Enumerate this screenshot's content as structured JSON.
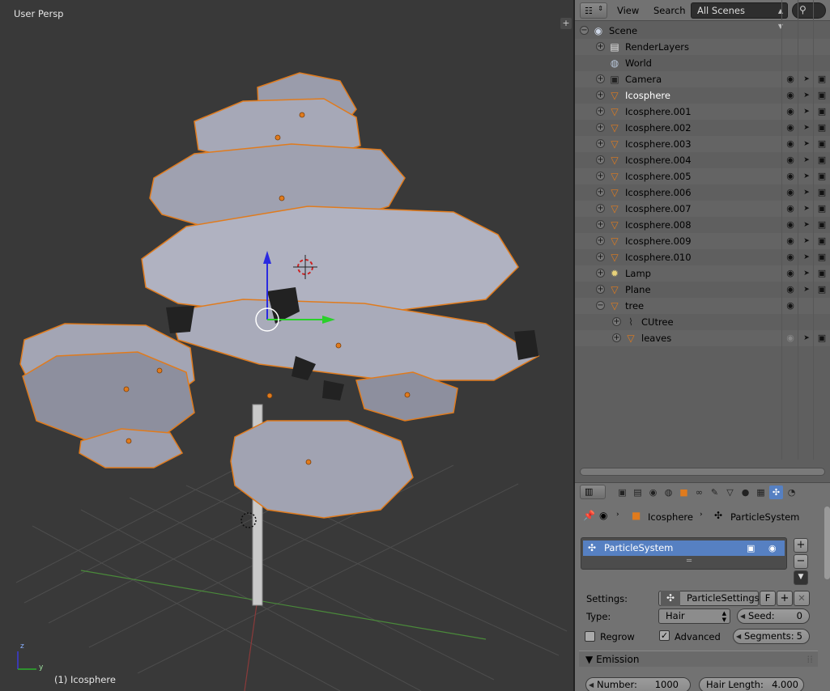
{
  "viewport": {
    "title": "User Persp",
    "active_object": "(1) Icosphere",
    "axis_z": "z",
    "axis_y": "y",
    "plus_button": "+"
  },
  "outliner": {
    "header": {
      "menu_view": "View",
      "menu_search": "Search",
      "scene_select": "All Scenes"
    },
    "rows": [
      {
        "name": "Scene",
        "level": 0,
        "expand": "−",
        "icon": "scene-icon",
        "glyph": "◉",
        "color": "#cfd8e8"
      },
      {
        "name": "RenderLayers",
        "level": 1,
        "expand": "+",
        "icon": "render-layers-icon",
        "glyph": "▤",
        "color": "#e6e6e6"
      },
      {
        "name": "World",
        "level": 1,
        "expand": "",
        "icon": "world-icon",
        "glyph": "◍",
        "color": "#b9c8dc"
      },
      {
        "name": "Camera",
        "level": 1,
        "expand": "+",
        "icon": "camera-icon",
        "glyph": "▣",
        "color": "#222222",
        "restrict": true
      },
      {
        "name": "Icosphere",
        "level": 1,
        "expand": "+",
        "icon": "mesh-object-icon",
        "glyph": "▽",
        "color": "#e07b1d",
        "selected": true,
        "restrict": true
      },
      {
        "name": "Icosphere.001",
        "level": 1,
        "expand": "+",
        "icon": "mesh-object-icon",
        "glyph": "▽",
        "color": "#e07b1d",
        "restrict": true
      },
      {
        "name": "Icosphere.002",
        "level": 1,
        "expand": "+",
        "icon": "mesh-object-icon",
        "glyph": "▽",
        "color": "#e07b1d",
        "restrict": true
      },
      {
        "name": "Icosphere.003",
        "level": 1,
        "expand": "+",
        "icon": "mesh-object-icon",
        "glyph": "▽",
        "color": "#e07b1d",
        "restrict": true
      },
      {
        "name": "Icosphere.004",
        "level": 1,
        "expand": "+",
        "icon": "mesh-object-icon",
        "glyph": "▽",
        "color": "#e07b1d",
        "restrict": true
      },
      {
        "name": "Icosphere.005",
        "level": 1,
        "expand": "+",
        "icon": "mesh-object-icon",
        "glyph": "▽",
        "color": "#e07b1d",
        "restrict": true
      },
      {
        "name": "Icosphere.006",
        "level": 1,
        "expand": "+",
        "icon": "mesh-object-icon",
        "glyph": "▽",
        "color": "#e07b1d",
        "restrict": true
      },
      {
        "name": "Icosphere.007",
        "level": 1,
        "expand": "+",
        "icon": "mesh-object-icon",
        "glyph": "▽",
        "color": "#e07b1d",
        "restrict": true
      },
      {
        "name": "Icosphere.008",
        "level": 1,
        "expand": "+",
        "icon": "mesh-object-icon",
        "glyph": "▽",
        "color": "#e07b1d",
        "restrict": true
      },
      {
        "name": "Icosphere.009",
        "level": 1,
        "expand": "+",
        "icon": "mesh-object-icon",
        "glyph": "▽",
        "color": "#e07b1d",
        "restrict": true
      },
      {
        "name": "Icosphere.010",
        "level": 1,
        "expand": "+",
        "icon": "mesh-object-icon",
        "glyph": "▽",
        "color": "#e07b1d",
        "restrict": true
      },
      {
        "name": "Lamp",
        "level": 1,
        "expand": "+",
        "icon": "lamp-icon",
        "glyph": "✹",
        "color": "#e8d27a",
        "restrict": true
      },
      {
        "name": "Plane",
        "level": 1,
        "expand": "+",
        "icon": "mesh-object-icon",
        "glyph": "▽",
        "color": "#e07b1d",
        "restrict": true
      },
      {
        "name": "tree",
        "level": 1,
        "expand": "−",
        "icon": "empty-object-icon",
        "glyph": "▽",
        "color": "#e07b1d",
        "restrict_eye_only": true
      },
      {
        "name": "CUtree",
        "level": 2,
        "expand": "+",
        "icon": "curve-icon",
        "glyph": "⌇",
        "color": "#222222"
      },
      {
        "name": "leaves",
        "level": 2,
        "expand": "+",
        "icon": "mesh-object-icon",
        "glyph": "▽",
        "color": "#e07b1d",
        "restrict": true,
        "eye_dim": true
      }
    ]
  },
  "properties": {
    "breadcrumb": {
      "object": "Icosphere",
      "particle_system": "ParticleSystem"
    },
    "list_item": "ParticleSystem",
    "settings_label": "Settings:",
    "settings_value": "ParticleSettings",
    "settings_f": "F",
    "type_label": "Type:",
    "type_value": "Hair",
    "seed_label": "Seed:",
    "seed_value": "0",
    "regrow_label": "Regrow",
    "regrow_checked": false,
    "advanced_label": "Advanced",
    "advanced_checked": true,
    "segments_label": "Segments:",
    "segments_value": "5",
    "emission_header": "Emission",
    "number_label": "Number:",
    "number_value": "1000",
    "hair_length_label": "Hair Length:",
    "hair_length_value": "4.000"
  }
}
